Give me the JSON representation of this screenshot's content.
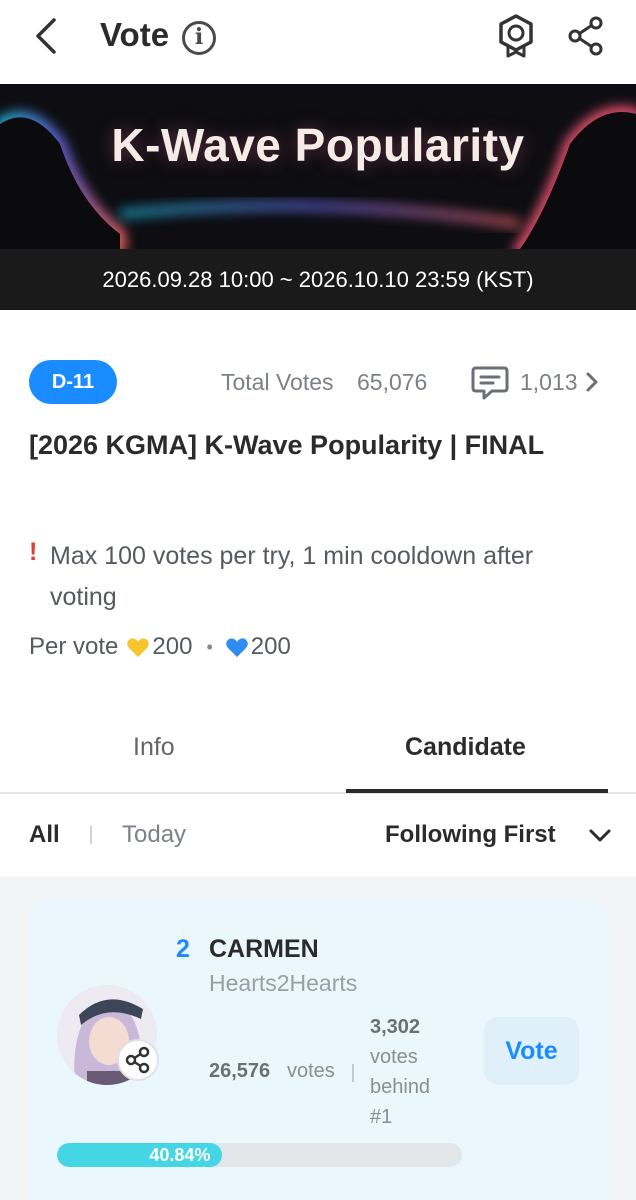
{
  "header": {
    "title": "Vote",
    "info_icon": "info-circle-icon",
    "badge_icon": "medal-badge-icon",
    "share_icon": "share-icon"
  },
  "banner": {
    "title": "K-Wave Popularity",
    "period": "2026.09.28 10:00 ~ 2026.10.10 23:59 (KST)"
  },
  "vote": {
    "dday": "D-11",
    "total_votes_label": "Total Votes",
    "total_votes": "65,076",
    "comment_count": "1,013",
    "title": "[2026 KGMA] K-Wave Popularity | FINAL",
    "notice": "Max 100 votes per try, 1 min cooldown after voting",
    "per_vote_label": "Per vote",
    "cost_gold": "200",
    "cost_blue": "200"
  },
  "tabs": [
    {
      "label": "Info",
      "active": false
    },
    {
      "label": "Candidate",
      "active": true
    }
  ],
  "filters": {
    "all": "All",
    "today": "Today",
    "sort": "Following First"
  },
  "candidates": [
    {
      "rank": "2",
      "name": "CARMEN",
      "group": "Hearts2Hearts",
      "votes": "26,576",
      "votes_unit": "votes",
      "behind_count": "3,302",
      "behind_text": "votes behind #1",
      "vote_button": "Vote",
      "percent_label": "40.84%",
      "percent": 40.84
    }
  ],
  "colors": {
    "accent": "#1a8cff",
    "progress": "#45d6e6",
    "heart_gold": "#f7c52b",
    "heart_blue": "#2f8cf5",
    "alert": "#e53935"
  }
}
